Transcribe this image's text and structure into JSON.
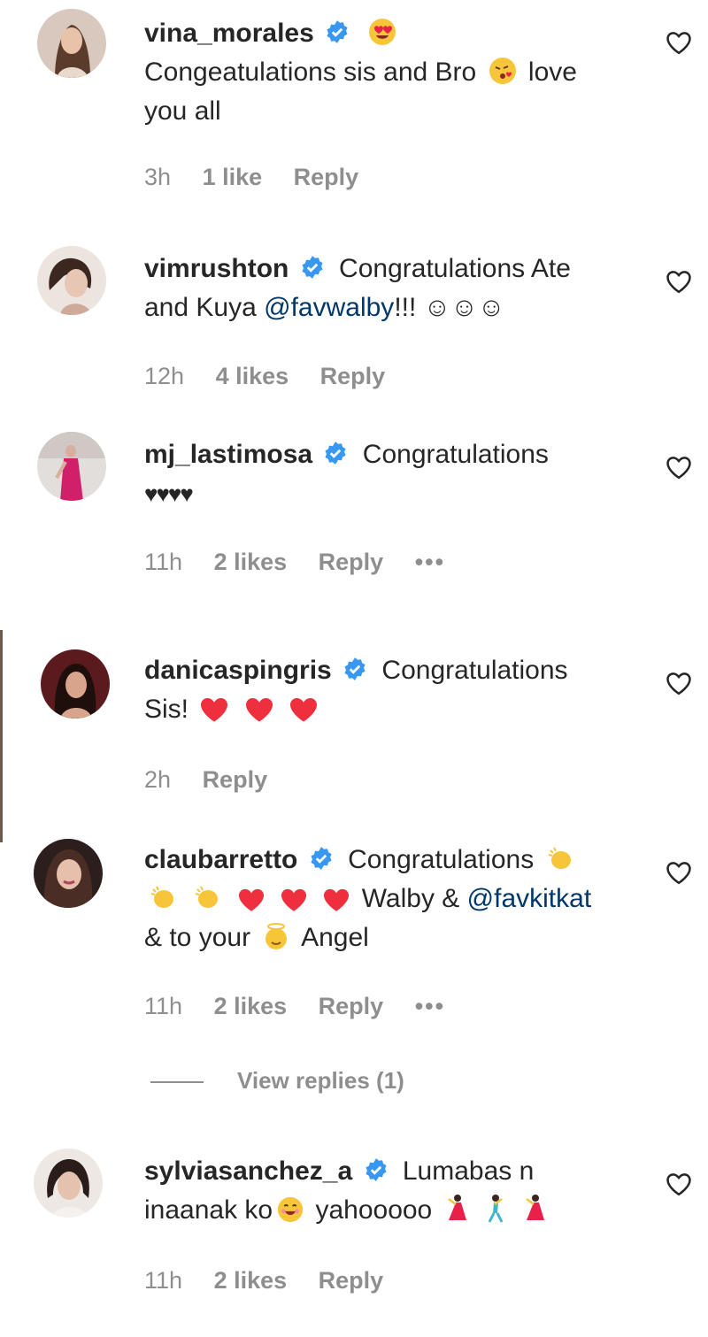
{
  "comments": [
    {
      "username": "vina_morales",
      "text_lines": [
        "Congeatulations sis and Bro",
        "love",
        "you all"
      ],
      "time": "3h",
      "likes": "1 like",
      "reply": "Reply",
      "avatar_color": "#b08d7a"
    },
    {
      "username": "vimrushton",
      "text_lines": [
        "Congratulations Ate",
        "and Kuya",
        "@favwalby",
        "!!! ☺☺☺"
      ],
      "time": "12h",
      "likes": "4 likes",
      "reply": "Reply",
      "avatar_color": "#c9b1a4"
    },
    {
      "username": "mj_lastimosa",
      "text_lines": [
        "Congratulations",
        "♥♥♥♥"
      ],
      "time": "11h",
      "likes": "2 likes",
      "reply": "Reply",
      "more": "•••",
      "avatar_color": "#c7c2c0"
    },
    {
      "username": "danicaspingris",
      "text_lines": [
        "Congratulations",
        "Sis!"
      ],
      "time": "2h",
      "reply": "Reply",
      "avatar_color": "#6e2a2a"
    },
    {
      "username": "claubarretto",
      "text_lines": [
        "Congratulations",
        "Walby &",
        "@favkitkat",
        "& to your",
        "Angel"
      ],
      "time": "11h",
      "likes": "2 likes",
      "reply": "Reply",
      "more": "•••",
      "view_replies": "View replies (1)",
      "avatar_color": "#8a6a5e"
    },
    {
      "username": "sylviasanchez_a",
      "text_lines": [
        "Lumabas n",
        "inaanak ko",
        "yahooooo"
      ],
      "time": "11h",
      "likes": "2 likes",
      "reply": "Reply",
      "avatar_color": "#a49892"
    }
  ],
  "colors": {
    "verified": "#3897f0",
    "heart_red": "#ed2f3e",
    "muted": "#8e8e8e",
    "mention": "#00376b"
  }
}
